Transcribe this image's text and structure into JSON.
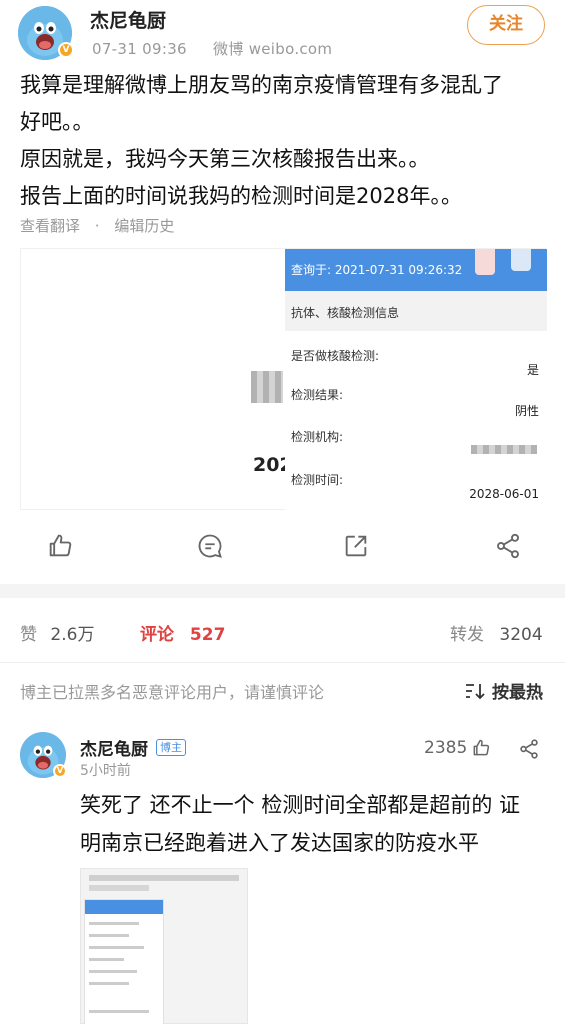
{
  "post": {
    "author": "杰尼龟厨",
    "timestamp": "07-31 09:36",
    "source": "微博 weibo.com",
    "follow_label": "关注",
    "text_lines": [
      "我算是理解微博上朋友骂的南京疫情管理有多混乱了",
      "好吧。。",
      "原因就是，我妈今天第三次核酸报告出来。。",
      "报告上面的时间说我妈的检测时间是2028年。。"
    ],
    "translate_label": "查看翻译",
    "separator": "·",
    "edit_history_label": "编辑历史"
  },
  "report": {
    "left_partial_text": "202",
    "query_time": "查询于: 2021-07-31 09:26:32",
    "section_title": "抗体、核酸检测信息",
    "rows": [
      {
        "label": "是否做核酸检测:",
        "value": "是"
      },
      {
        "label": "检测结果:",
        "value": "阴性"
      },
      {
        "label": "检测机构:",
        "value": ""
      },
      {
        "label": "检测时间:",
        "value": "2028-06-01"
      }
    ]
  },
  "actions": {
    "like_icon": "thumbs-up-icon",
    "comment_icon": "comment-icon",
    "share_icon": "share-icon",
    "more_icon": "share-nodes-icon"
  },
  "stats": {
    "likes_label": "赞",
    "likes_count": "2.6万",
    "comments_label": "评论",
    "comments_count": "527",
    "reposts_label": "转发",
    "reposts_count": "3204"
  },
  "comments_header": {
    "notice": "博主已拉黑多名恶意评论用户，请谨慎评论",
    "sort_label": "按最热"
  },
  "comment": {
    "author": "杰尼龟厨",
    "badge": "博主",
    "time": "5小时前",
    "likes": "2385",
    "text_lines": [
      "笑死了 还不止一个 检测时间全部都是超前的 证",
      "明南京已经跑着进入了发达国家的防疫水平"
    ]
  },
  "colors": {
    "accent_orange": "#e8842a",
    "active_red": "#e04141",
    "report_blue": "#4a90e2"
  }
}
